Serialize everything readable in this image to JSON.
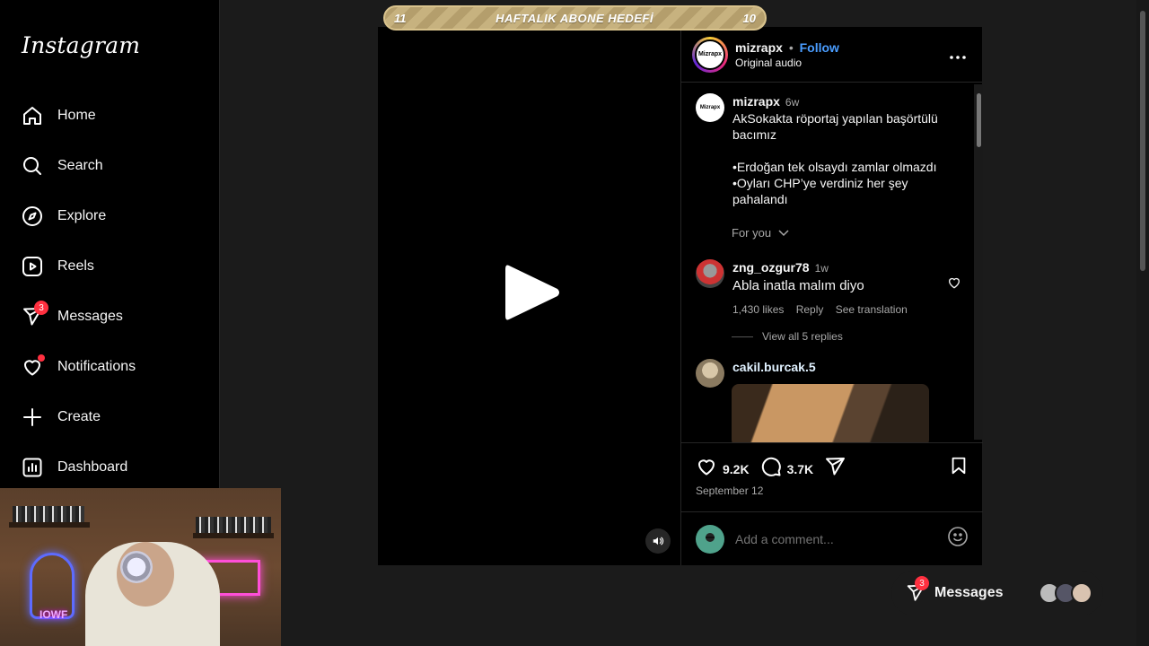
{
  "sidebar": {
    "logo": "Instagram",
    "items": [
      {
        "label": "Home"
      },
      {
        "label": "Search"
      },
      {
        "label": "Explore"
      },
      {
        "label": "Reels"
      },
      {
        "label": "Messages",
        "badge": "3"
      },
      {
        "label": "Notifications"
      },
      {
        "label": "Create"
      },
      {
        "label": "Dashboard"
      }
    ]
  },
  "banner": {
    "left": "11",
    "title": "HAFTALIK ABONE HEDEFİ",
    "right": "10"
  },
  "post": {
    "username": "mizrapx",
    "separator": "•",
    "follow_label": "Follow",
    "audio": "Original audio",
    "avatar_text": "Mizrapx",
    "caption": {
      "username": "mizrapx",
      "time": "6w",
      "text": "AkSokakta röportaj yapılan başörtülü bacımız\n\n•Erdoğan tek olsaydı zamlar olmazdı\n•Oyları CHP’ye verdiniz her şey pahalandı"
    },
    "for_you": "For you",
    "comments": [
      {
        "username": "zng_ozgur78",
        "time": "1w",
        "text": "Abla inatla malım diyo",
        "likes": "1,430 likes",
        "reply": "Reply",
        "translate": "See translation",
        "view_replies": "View all 5 replies"
      },
      {
        "username": "cakil.burcak.5"
      }
    ],
    "like_count": "9.2K",
    "comment_count": "3.7K",
    "date": "September 12",
    "add_comment_placeholder": "Add a comment..."
  },
  "messages_pill": {
    "label": "Messages",
    "badge": "3"
  },
  "webcam": {
    "neon_text": "IOWF"
  }
}
